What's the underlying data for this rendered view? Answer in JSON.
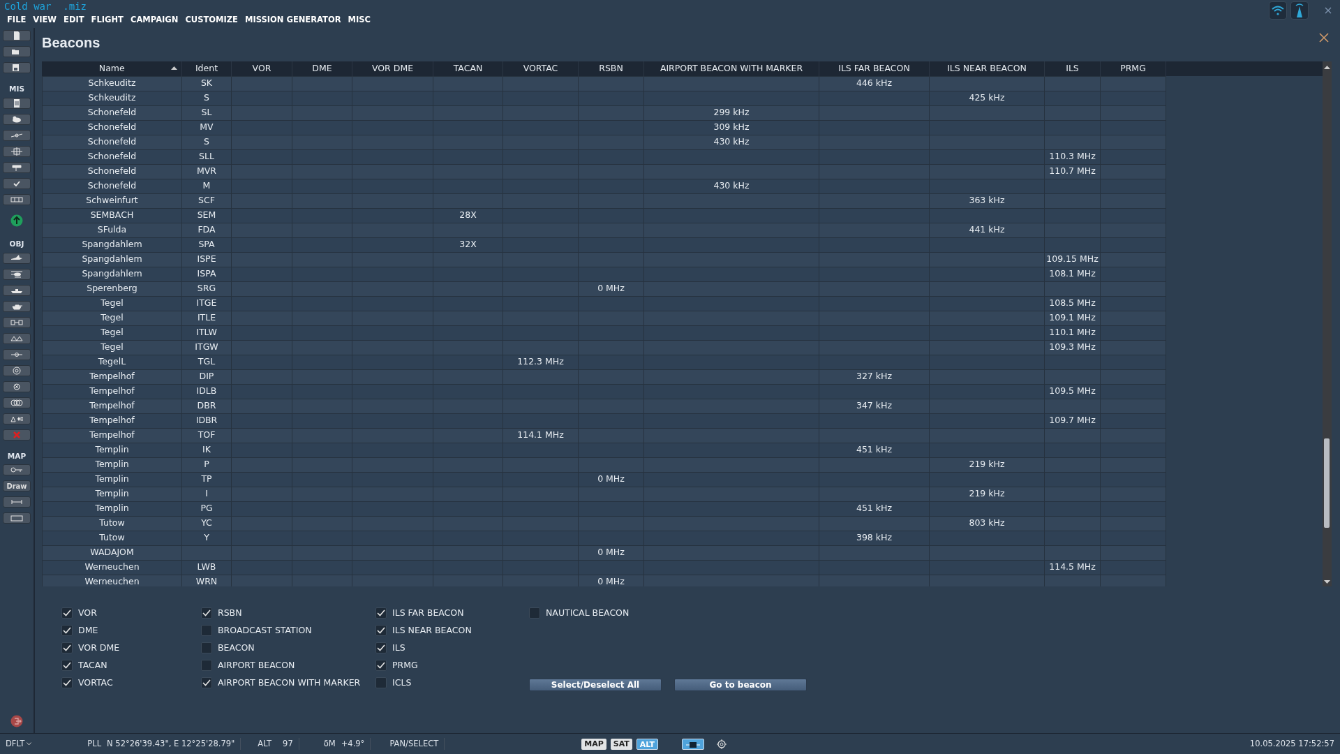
{
  "window": {
    "file_title": "Cold war  .miz"
  },
  "menu": [
    "FILE",
    "VIEW",
    "EDIT",
    "FLIGHT",
    "CAMPAIGN",
    "CUSTOMIZE",
    "MISSION GENERATOR",
    "MISC"
  ],
  "toolbar": {
    "sections": [
      {
        "label": "MIS"
      },
      {
        "label": "OBJ"
      },
      {
        "label": "MAP"
      }
    ],
    "draw_button": "Draw"
  },
  "dialog": {
    "title": "Beacons",
    "columns": [
      {
        "label": "Name",
        "sorted": true
      },
      {
        "label": "Ident",
        "sorted": false
      },
      {
        "label": "VOR",
        "sorted": false
      },
      {
        "label": "DME",
        "sorted": false
      },
      {
        "label": "VOR DME",
        "sorted": false
      },
      {
        "label": "TACAN",
        "sorted": false
      },
      {
        "label": "VORTAC",
        "sorted": false
      },
      {
        "label": "RSBN",
        "sorted": false
      },
      {
        "label": "AIRPORT BEACON WITH MARKER",
        "sorted": false
      },
      {
        "label": "ILS FAR BEACON",
        "sorted": false
      },
      {
        "label": "ILS NEAR BEACON",
        "sorted": false
      },
      {
        "label": "ILS",
        "sorted": false
      },
      {
        "label": "PRMG",
        "sorted": false
      }
    ],
    "rows": [
      {
        "cells": [
          "Schkeuditz",
          "SK",
          null,
          null,
          null,
          null,
          null,
          null,
          null,
          "446 kHz",
          null,
          null,
          null
        ]
      },
      {
        "cells": [
          "Schkeuditz",
          "S",
          null,
          null,
          null,
          null,
          null,
          null,
          null,
          null,
          "425 kHz",
          null,
          null
        ]
      },
      {
        "cells": [
          "Schonefeld",
          "SL",
          null,
          null,
          null,
          null,
          null,
          null,
          "299 kHz",
          null,
          null,
          null,
          null
        ]
      },
      {
        "cells": [
          "Schonefeld",
          "MV",
          null,
          null,
          null,
          null,
          null,
          null,
          "309 kHz",
          null,
          null,
          null,
          null
        ]
      },
      {
        "cells": [
          "Schonefeld",
          "S",
          null,
          null,
          null,
          null,
          null,
          null,
          "430 kHz",
          null,
          null,
          null,
          null
        ]
      },
      {
        "cells": [
          "Schonefeld",
          "SLL",
          null,
          null,
          null,
          null,
          null,
          null,
          null,
          null,
          null,
          "110.3 MHz",
          null
        ]
      },
      {
        "cells": [
          "Schonefeld",
          "MVR",
          null,
          null,
          null,
          null,
          null,
          null,
          null,
          null,
          null,
          "110.7 MHz",
          null
        ]
      },
      {
        "cells": [
          "Schonefeld",
          "M",
          null,
          null,
          null,
          null,
          null,
          null,
          "430 kHz",
          null,
          null,
          null,
          null
        ]
      },
      {
        "cells": [
          "Schweinfurt",
          "SCF",
          null,
          null,
          null,
          null,
          null,
          null,
          null,
          null,
          "363 kHz",
          null,
          null
        ]
      },
      {
        "cells": [
          "SEMBACH",
          "SEM",
          null,
          null,
          null,
          "28X",
          null,
          null,
          null,
          null,
          null,
          null,
          null
        ]
      },
      {
        "cells": [
          "SFulda",
          "FDA",
          null,
          null,
          null,
          null,
          null,
          null,
          null,
          null,
          "441 kHz",
          null,
          null
        ]
      },
      {
        "cells": [
          "Spangdahlem",
          "SPA",
          null,
          null,
          null,
          "32X",
          null,
          null,
          null,
          null,
          null,
          null,
          null
        ]
      },
      {
        "cells": [
          "Spangdahlem",
          "ISPE",
          null,
          null,
          null,
          null,
          null,
          null,
          null,
          null,
          null,
          "109.15 MHz",
          null
        ]
      },
      {
        "cells": [
          "Spangdahlem",
          "ISPA",
          null,
          null,
          null,
          null,
          null,
          null,
          null,
          null,
          null,
          "108.1 MHz",
          null
        ]
      },
      {
        "cells": [
          "Sperenberg",
          "SRG",
          null,
          null,
          null,
          null,
          null,
          "0 MHz",
          null,
          null,
          null,
          null,
          null
        ]
      },
      {
        "cells": [
          "Tegel",
          "ITGE",
          null,
          null,
          null,
          null,
          null,
          null,
          null,
          null,
          null,
          "108.5 MHz",
          null
        ]
      },
      {
        "cells": [
          "Tegel",
          "ITLE",
          null,
          null,
          null,
          null,
          null,
          null,
          null,
          null,
          null,
          "109.1 MHz",
          null
        ]
      },
      {
        "cells": [
          "Tegel",
          "ITLW",
          null,
          null,
          null,
          null,
          null,
          null,
          null,
          null,
          null,
          "110.1 MHz",
          null
        ]
      },
      {
        "cells": [
          "Tegel",
          "ITGW",
          null,
          null,
          null,
          null,
          null,
          null,
          null,
          null,
          null,
          "109.3 MHz",
          null
        ]
      },
      {
        "cells": [
          "TegelL",
          "TGL",
          null,
          null,
          null,
          null,
          "112.3 MHz",
          null,
          null,
          null,
          null,
          null,
          null
        ]
      },
      {
        "cells": [
          "Tempelhof",
          "DIP",
          null,
          null,
          null,
          null,
          null,
          null,
          null,
          "327 kHz",
          null,
          null,
          null
        ]
      },
      {
        "cells": [
          "Tempelhof",
          "IDLB",
          null,
          null,
          null,
          null,
          null,
          null,
          null,
          null,
          null,
          "109.5 MHz",
          null
        ]
      },
      {
        "cells": [
          "Tempelhof",
          "DBR",
          null,
          null,
          null,
          null,
          null,
          null,
          null,
          "347 kHz",
          null,
          null,
          null
        ]
      },
      {
        "cells": [
          "Tempelhof",
          "IDBR",
          null,
          null,
          null,
          null,
          null,
          null,
          null,
          null,
          null,
          "109.7 MHz",
          null
        ]
      },
      {
        "cells": [
          "Tempelhof",
          "TOF",
          null,
          null,
          null,
          null,
          "114.1 MHz",
          null,
          null,
          null,
          null,
          null,
          null
        ]
      },
      {
        "cells": [
          "Templin",
          "IK",
          null,
          null,
          null,
          null,
          null,
          null,
          null,
          "451 kHz",
          null,
          null,
          null
        ]
      },
      {
        "cells": [
          "Templin",
          "P",
          null,
          null,
          null,
          null,
          null,
          null,
          null,
          null,
          "219 kHz",
          null,
          null
        ]
      },
      {
        "cells": [
          "Templin",
          "TP",
          null,
          null,
          null,
          null,
          null,
          "0 MHz",
          null,
          null,
          null,
          null,
          null
        ]
      },
      {
        "cells": [
          "Templin",
          "I",
          null,
          null,
          null,
          null,
          null,
          null,
          null,
          null,
          "219 kHz",
          null,
          null
        ]
      },
      {
        "cells": [
          "Templin",
          "PG",
          null,
          null,
          null,
          null,
          null,
          null,
          null,
          "451 kHz",
          null,
          null,
          null
        ]
      },
      {
        "cells": [
          "Tutow",
          "YC",
          null,
          null,
          null,
          null,
          null,
          null,
          null,
          null,
          "803 kHz",
          null,
          null
        ]
      },
      {
        "cells": [
          "Tutow",
          "Y",
          null,
          null,
          null,
          null,
          null,
          null,
          null,
          "398 kHz",
          null,
          null,
          null
        ]
      },
      {
        "cells": [
          "WADAJOM",
          null,
          null,
          null,
          null,
          null,
          null,
          "0 MHz",
          null,
          null,
          null,
          null,
          null
        ]
      },
      {
        "cells": [
          "Werneuchen",
          "LWB",
          null,
          null,
          null,
          null,
          null,
          null,
          null,
          null,
          null,
          "114.5 MHz",
          null
        ]
      },
      {
        "cells": [
          "Werneuchen",
          "WRN",
          null,
          null,
          null,
          null,
          null,
          "0 MHz",
          null,
          null,
          null,
          null,
          null
        ]
      }
    ],
    "filter_groups": [
      [
        {
          "label": "VOR",
          "checked": true
        },
        {
          "label": "DME",
          "checked": true
        },
        {
          "label": "VOR DME",
          "checked": true
        },
        {
          "label": "TACAN",
          "checked": true
        },
        {
          "label": "VORTAC",
          "checked": true
        }
      ],
      [
        {
          "label": "RSBN",
          "checked": true
        },
        {
          "label": "BROADCAST STATION",
          "checked": false
        },
        {
          "label": "BEACON",
          "checked": false
        },
        {
          "label": "AIRPORT BEACON",
          "checked": false
        },
        {
          "label": "AIRPORT BEACON WITH MARKER",
          "checked": true
        }
      ],
      [
        {
          "label": "ILS FAR BEACON",
          "checked": true
        },
        {
          "label": "ILS NEAR BEACON",
          "checked": true
        },
        {
          "label": "ILS",
          "checked": true
        },
        {
          "label": "PRMG",
          "checked": true
        },
        {
          "label": "ICLS",
          "checked": false
        }
      ],
      [
        {
          "label": "NAUTICAL BEACON",
          "checked": false
        }
      ]
    ],
    "buttons": [
      "Select/Deselect All",
      "Go to beacon"
    ]
  },
  "status_bar": {
    "profile": "DFLT",
    "coord_label": "PLL",
    "coords": "N 52°26'39.43\", E 12°25'28.79\"",
    "alt_label": "ALT",
    "alt": "97",
    "dm_label": "δM",
    "dm": "+4.9°",
    "mode": "PAN/SELECT",
    "map_modes": [
      {
        "label": "MAP",
        "selected": false
      },
      {
        "label": "SAT",
        "selected": false
      },
      {
        "label": "ALT",
        "selected": true
      }
    ],
    "datetime": "10.05.2025 17:52:57"
  }
}
